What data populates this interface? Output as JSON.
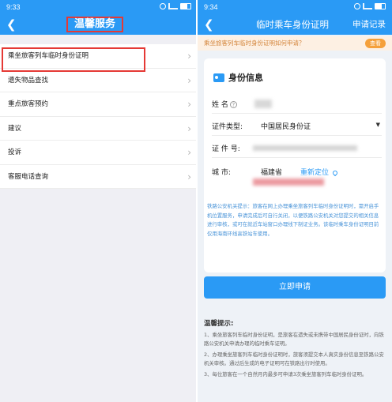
{
  "left": {
    "status_time": "9:33",
    "title": "温馨服务",
    "menu": [
      {
        "label": "乘坐旅客列车临时身份证明"
      },
      {
        "label": "遗失物品查找"
      },
      {
        "label": "重点旅客预约"
      },
      {
        "label": "建议"
      },
      {
        "label": "投诉"
      },
      {
        "label": "客服电话查询"
      }
    ]
  },
  "right": {
    "status_time": "9:34",
    "title": "临时乘车身份证明",
    "apply_record": "申请记录",
    "notice": "乘坐旅客列车临时身份证明如何申请？",
    "notice_button": "查看",
    "card_title": "身份信息",
    "form": {
      "name_label": "姓  名",
      "id_type_label": "证件类型:",
      "id_type_value": "中国居民身份证",
      "id_no_label": "证 件 号:",
      "city_label": "城    市:",
      "city_value": "福建省",
      "relocate": "重新定位"
    },
    "police_note": "铁路公安机关提示：旅客在网上办理乘坐旅客列车临时身份证明时，需开启手机位置服务，申请完成后可自行关闭，以便铁路公安机关对您提交的相关信息进行审核，或可在就近车站窗口办理线下制证业务。该临时乘车身份证明目前仅用海南环线高铁站车使用。",
    "apply_button": "立即申请",
    "tips_title": "温馨提示:",
    "tips": [
      "1、乘坐旅客列车临时身份证明，是旅客在遗失或未携带中国居民身份证时，向铁路公安机关申请办理的临时乘车证明。",
      "2、办理乘坐旅客列车临时身份证明时，旅客须提交本人真实身份信息至铁路公安机关审核。通过后生成的电子证明可在铁路出行时使用。",
      "3、每位旅客在一个自然月内最多可申请3次乘坐旅客列车临时身份证明。"
    ]
  }
}
